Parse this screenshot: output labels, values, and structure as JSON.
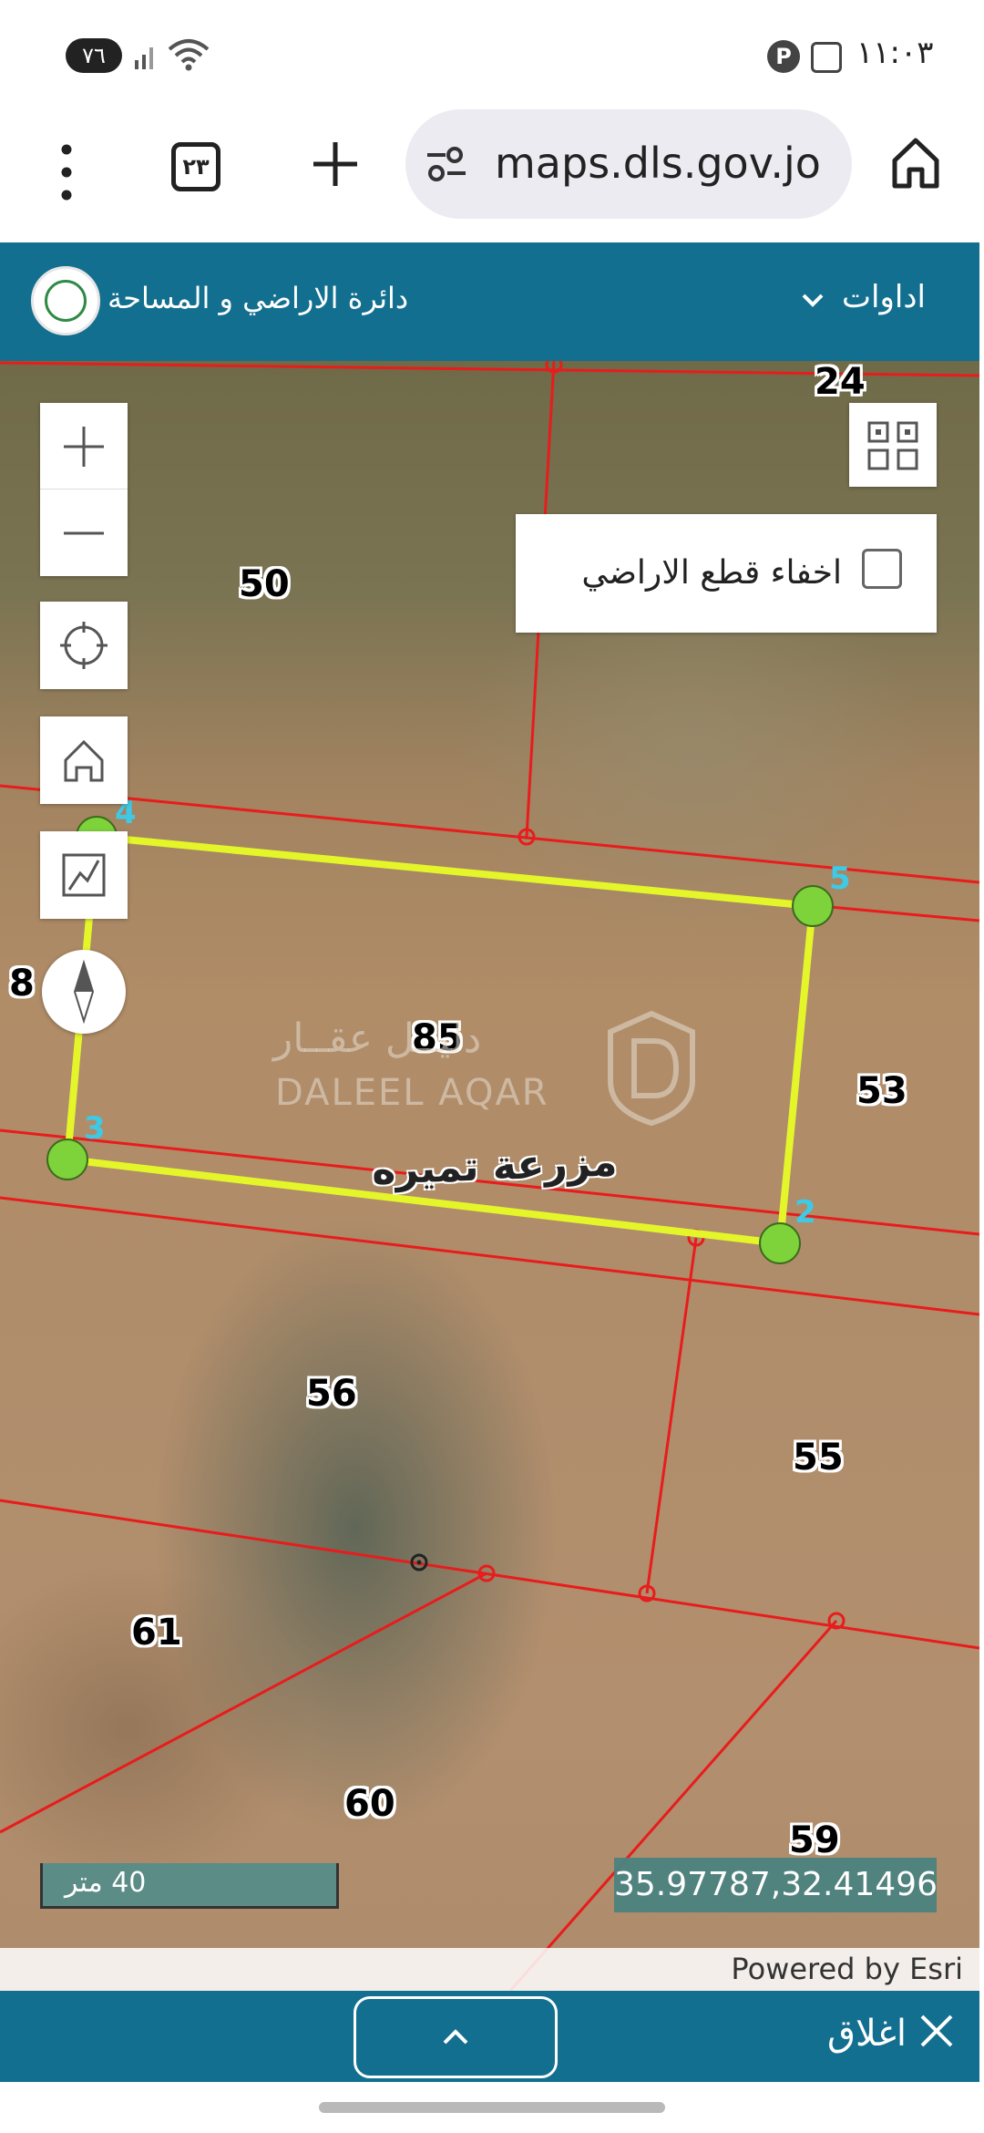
{
  "status_bar": {
    "battery": "٧٦",
    "time": "١١:٠٣",
    "signal_icon": "signal-icon",
    "wifi_icon": "wifi-icon"
  },
  "browser": {
    "tab_count": "٢٣",
    "url": "maps.dls.gov.jo"
  },
  "header": {
    "title": "دائرة الاراضي و المساحة",
    "tools_label": "اداوات"
  },
  "map": {
    "hide_parcels_label": "اخفاء قطع الاراضي",
    "hide_parcels_checked": false,
    "farm_name": "مزرعة تميره",
    "parcels": [
      "24",
      "50",
      "85",
      "53",
      "56",
      "55",
      "61",
      "60",
      "59",
      "8"
    ],
    "vertices": [
      "4",
      "5",
      "3",
      "2"
    ],
    "watermark_ar": "دليــل عقــار",
    "watermark_en": "DALEEL AQAR",
    "scale": "40 متر",
    "coordinates": "35.97787,32.41496",
    "attribution": "Powered by Esri",
    "colors": {
      "parcel_lines": "#e81c1c",
      "selected_parcel": "#e4f52a",
      "vertex_fill": "#7ed23a",
      "vertex_label": "#3ec9e6"
    }
  },
  "bottom_bar": {
    "close_label": "اغلاق"
  },
  "colors": {
    "header": "#136f8f"
  }
}
